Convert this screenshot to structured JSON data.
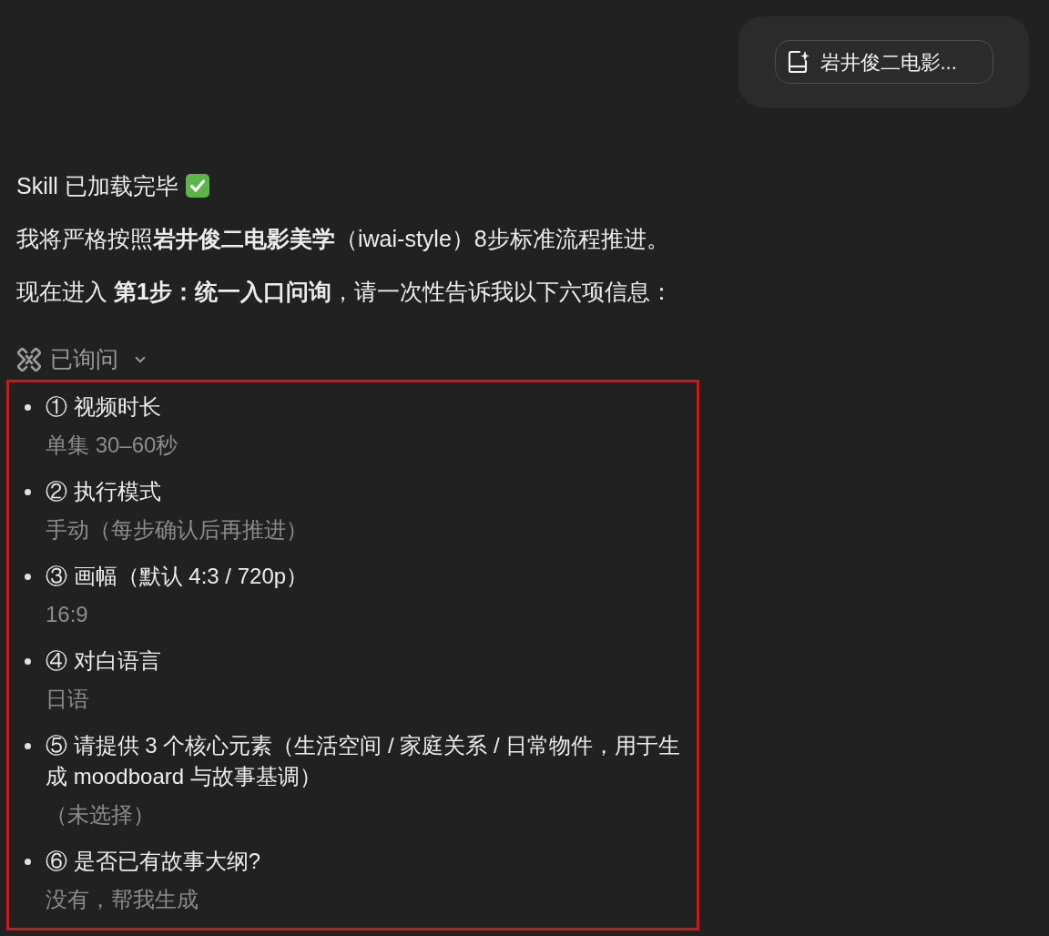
{
  "user_message": {
    "attachment": {
      "title": "岩井俊二电影..."
    }
  },
  "assistant_message": {
    "paragraphs": [
      {
        "text": "Skill 已加载完毕",
        "done": true
      },
      {
        "text": "我将严格按照**岩井俊二电影美学**（iwai-style）8步标准流程推进。"
      },
      {
        "text": "现在进入 **第1步：统一入口问询**，请一次性告诉我以下六项信息："
      }
    ],
    "ask_panel": {
      "label": "已询问",
      "expanded": true,
      "items": [
        {
          "question": "① 视频时长",
          "answer": "单集 30–60秒"
        },
        {
          "question": "② 执行模式",
          "answer": "手动（每步确认后再推进）"
        },
        {
          "question": "③ 画幅（默认 4:3 / 720p）",
          "answer": "16:9"
        },
        {
          "question": "④ 对白语言",
          "answer": "日语"
        },
        {
          "question": "⑤ 请提供 3 个核心元素（生活空间 / 家庭关系 / 日常物件，用于生成 moodboard 与故事基调）",
          "answer": "（未选择）"
        },
        {
          "question": "⑥ 是否已有故事大纲?",
          "answer": "没有，帮我生成"
        }
      ]
    }
  }
}
